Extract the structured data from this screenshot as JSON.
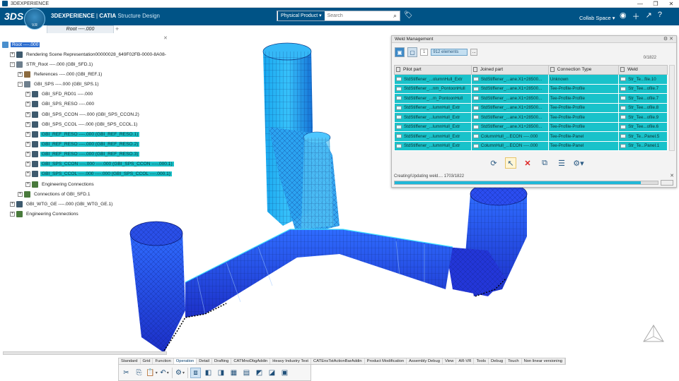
{
  "window": {
    "title": "3DEXPERIENCE",
    "controls": [
      "—",
      "❐",
      "✕"
    ]
  },
  "topbar": {
    "brand_bold": "3DEXPERIENCE",
    "brand_sep": " | ",
    "brand_product": "CATIA",
    "brand_app": " Structure Design",
    "compass_label": "V.R",
    "search_scope": "Physical Product",
    "search_placeholder": "Search",
    "collab_space": "Collab Space",
    "icons": [
      "user-icon",
      "add-icon",
      "share-icon",
      "help-icon"
    ]
  },
  "tabs": {
    "active": "Root ----.000",
    "add": "+"
  },
  "tree": {
    "close_label": "✕",
    "rows": [
      {
        "label": "Root ----.000",
        "indent": 0,
        "exp": "",
        "icon": "root",
        "style": "sel-root"
      },
      {
        "label": "Rendering Scene Representation00000028_649F02FB-0000-8A08-",
        "indent": 1,
        "exp": "+",
        "icon": "part",
        "style": ""
      },
      {
        "label": "STR_Root ----.000 (GBI_SFD.1)",
        "indent": 1,
        "exp": "−",
        "icon": "asm",
        "style": ""
      },
      {
        "label": "References ----.000 (GBI_REF.1)",
        "indent": 2,
        "exp": "+",
        "icon": "ref",
        "style": ""
      },
      {
        "label": "GBI_SPS ----.000 (GBI_SPS.1)",
        "indent": 2,
        "exp": "−",
        "icon": "asm",
        "style": ""
      },
      {
        "label": "GBI_SFD_RD01 ----.000",
        "indent": 3,
        "exp": "+",
        "icon": "part",
        "style": ""
      },
      {
        "label": "GBI_SPS_RESO ----.000",
        "indent": 3,
        "exp": "+",
        "icon": "part",
        "style": ""
      },
      {
        "label": "GBI_SPS_CCON ----.000 (GBI_SPS_CCON.2)",
        "indent": 3,
        "exp": "+",
        "icon": "part",
        "style": ""
      },
      {
        "label": "GBI_SPS_CCOL ----.000 (GBI_SPS_CCOL.1)",
        "indent": 3,
        "exp": "+",
        "icon": "part",
        "style": ""
      },
      {
        "label": "GBI_REF_RESO ----.000 (GBI_REF_RESO.1)",
        "indent": 3,
        "exp": "+",
        "icon": "part",
        "style": "hl"
      },
      {
        "label": "GBI_REF_RESO ----.000 (GBI_REF_RESO.2)",
        "indent": 3,
        "exp": "+",
        "icon": "part",
        "style": "hl"
      },
      {
        "label": "GBI_REF_RESO ----.000 (GBI_REF_RESO.3)",
        "indent": 3,
        "exp": "+",
        "icon": "part",
        "style": "hl"
      },
      {
        "label": "GBI_SPS_CCON ----.000 ----.000 (GBI_SPS_CCON ----.000.1)",
        "indent": 3,
        "exp": "+",
        "icon": "part",
        "style": "hl"
      },
      {
        "label": "GBI_SPS_CCOL ----.000 ----.000 (GBI_SPS_CCOL ----.000.1)",
        "indent": 3,
        "exp": "+",
        "icon": "part",
        "style": "hl"
      },
      {
        "label": "Engineering Connections",
        "indent": 3,
        "exp": "+",
        "icon": "conn",
        "style": ""
      },
      {
        "label": "Connections of GBI_SFD.1",
        "indent": 2,
        "exp": "+",
        "icon": "conn",
        "style": ""
      },
      {
        "label": "GBI_WTG_GE ----.000 (GBI_WTG_GE.1)",
        "indent": 1,
        "exp": "+",
        "icon": "part",
        "style": ""
      },
      {
        "label": "Engineering Connections",
        "indent": 1,
        "exp": "+",
        "icon": "conn",
        "style": ""
      }
    ]
  },
  "weld_panel": {
    "title": "Weld Management",
    "title_controls": "⚙ ✕",
    "index_field": "1",
    "elements_field": "912 elements",
    "more": "...",
    "count": "0/1822",
    "columns": [
      "Pilot part",
      "Joined part",
      "Connection Type",
      "Weld"
    ],
    "rows": [
      [
        "StdStiffener_...olumnHull_Extr",
        "StdStiffener_...ane.X1+28500...",
        "Unknown",
        "Str_Te...file.10"
      ],
      [
        "StdStiffener_...nm_PontoonHull",
        "StdStiffener_...ane.X1+28500...",
        "Tee-Profile-Profile",
        "Str_Tee...ofile.7"
      ],
      [
        "StdStiffener_...m_PontoonHull",
        "StdStiffener_...ane.X1+28500...",
        "Tee-Profile-Profile",
        "Str_Tee...ofile.7"
      ],
      [
        "StdStiffener_...lumnHull_Extr",
        "StdStiffener_...ane.X1+28500...",
        "Tee-Profile-Profile",
        "Str_Tee...ofile.8"
      ],
      [
        "StdStiffener_...lumnHull_Extr",
        "StdStiffener_...ane.X1+28500...",
        "Tee-Profile-Profile",
        "Str_Tee...ofile.9"
      ],
      [
        "StdStiffener_...lumnHull_Extr",
        "StdStiffener_...ane.X1+28500...",
        "Tee-Profile-Profile",
        "Str_Tee...ofile.6"
      ],
      [
        "StdStiffener_...lumnHull_Extr",
        "ColumnHull_...ECON ----.000",
        "Tee-Profile-Panel",
        "Str_Te...Panel.5"
      ],
      [
        "StdStiffener_...lumnHull_Extr",
        "ColumnHull_...ECON ----.000",
        "Tee-Profile-Panel",
        "Str_Te...Panel.1"
      ]
    ],
    "status": "Creating/Updating weld.... 1703/1822",
    "progress": 0.935,
    "status_close": "✕"
  },
  "actionbar": {
    "tabs": [
      "Standard",
      "Grid",
      "Function",
      "Operation",
      "Detail",
      "Drafting",
      "CATMnoDbgAddin",
      "Heavy Industry Test",
      "CATEnsTstActionBarAddin",
      "Product Modification",
      "Assembly Debug",
      "View",
      "AR-VR",
      "Tools",
      "Debug",
      "Touch",
      "Non linear versioning"
    ],
    "active_tab": "Operation"
  },
  "colors": {
    "topbar": "#005386",
    "highlight": "#19c2ca",
    "model_blue": "#1a3fd6",
    "model_cyan": "#22aef2"
  }
}
